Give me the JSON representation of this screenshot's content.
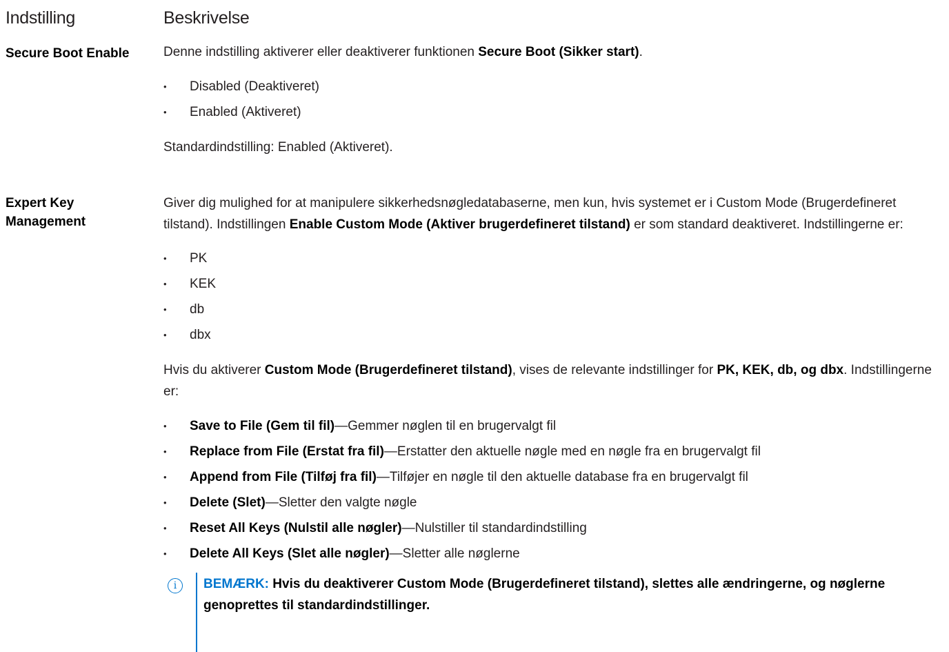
{
  "header": {
    "setting": "Indstilling",
    "description": "Beskrivelse"
  },
  "rows": [
    {
      "name": "Secure Boot Enable",
      "intro": {
        "before": "Denne indstilling aktiverer eller deaktiverer funktionen ",
        "bold": "Secure Boot (Sikker start)",
        "after": "."
      },
      "options": [
        "Disabled (Deaktiveret)",
        "Enabled (Aktiveret)"
      ],
      "default": "Standardindstilling: Enabled (Aktiveret)."
    },
    {
      "name": "Expert Key Management",
      "intro": {
        "before": "Giver dig mulighed for at manipulere sikkerhedsnøgledatabaserne, men kun, hvis systemet er i Custom Mode (Brugerdefineret tilstand). Indstillingen ",
        "bold": "Enable Custom Mode (Aktiver brugerdefineret tilstand)",
        "after": " er som standard deaktiveret. Indstillingerne er:"
      },
      "keys": [
        "PK",
        "KEK",
        "db",
        "dbx"
      ],
      "custom": {
        "before": "Hvis du aktiverer ",
        "bold1": "Custom Mode (Brugerdefineret tilstand)",
        "middle": ", vises de relevante indstillinger for ",
        "bold2": "PK, KEK, db, og dbx",
        "after": ". Indstillingerne er:"
      },
      "actions": [
        {
          "label": "Save to File (Gem til fil)",
          "text": "—Gemmer nøglen til en brugervalgt fil"
        },
        {
          "label": "Replace from File (Erstat fra fil)",
          "text": "—Erstatter den aktuelle nøgle med en nøgle fra en brugervalgt fil"
        },
        {
          "label": "Append from File (Tilføj fra fil)",
          "text": "—Tilføjer en nøgle til den aktuelle database fra en brugervalgt fil"
        },
        {
          "label": "Delete (Slet)",
          "text": "—Sletter den valgte nøgle"
        },
        {
          "label": "Reset All Keys (Nulstil alle nøgler)",
          "text": "—Nulstiller til standardindstilling"
        },
        {
          "label": "Delete All Keys (Slet alle nøgler)",
          "text": "—Sletter alle nøglerne"
        }
      ]
    }
  ],
  "note": {
    "icon": "info-icon",
    "label": "BEMÆRK:",
    "text": " Hvis du deaktiverer Custom Mode (Brugerdefineret tilstand), slettes alle ændringerne, og nøglerne genoprettes til standardindstillinger."
  },
  "colors": {
    "note_accent": "#0076ce",
    "text": "#231f20"
  }
}
